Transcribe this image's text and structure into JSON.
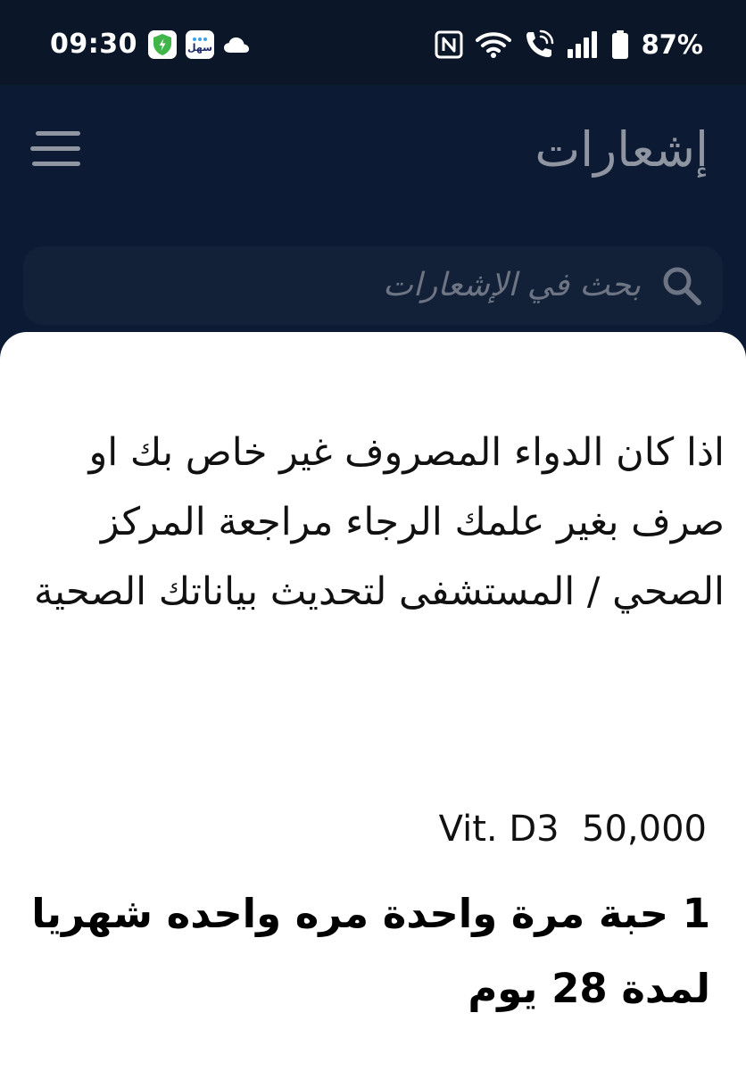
{
  "status_bar": {
    "time": "09:30",
    "battery": "87%",
    "sahl_label": "سهل"
  },
  "header": {
    "title": "إشعارات"
  },
  "search": {
    "placeholder": "بحث في الإشعارات"
  },
  "notification": {
    "message": "اذا كان الدواء المصروف غير خاص بك او صرف بغير علمك الرجاء مراجعة المركز الصحي / المستشفى لتحديث بياناتك الصحية",
    "medication": "Vit. D3  50,000",
    "dosage": "1 حبة مرة واحدة مره واحده شهريا لمدة  28 يوم"
  },
  "icons": {
    "menu": "menu-icon",
    "search": "search-icon",
    "shield": "shield-icon",
    "cloud": "cloud-icon",
    "nfc": "nfc-icon",
    "wifi": "wifi-icon",
    "wifi_call": "wifi-call-icon",
    "signal": "signal-icon",
    "battery": "battery-icon"
  },
  "colors": {
    "background": "#0c1a33",
    "status_bar": "#0b1628",
    "search_box": "#122038",
    "sheet": "#ffffff",
    "title_text": "#8f95a1",
    "placeholder_text": "#6d7483",
    "shield_green": "#3fb54a"
  }
}
